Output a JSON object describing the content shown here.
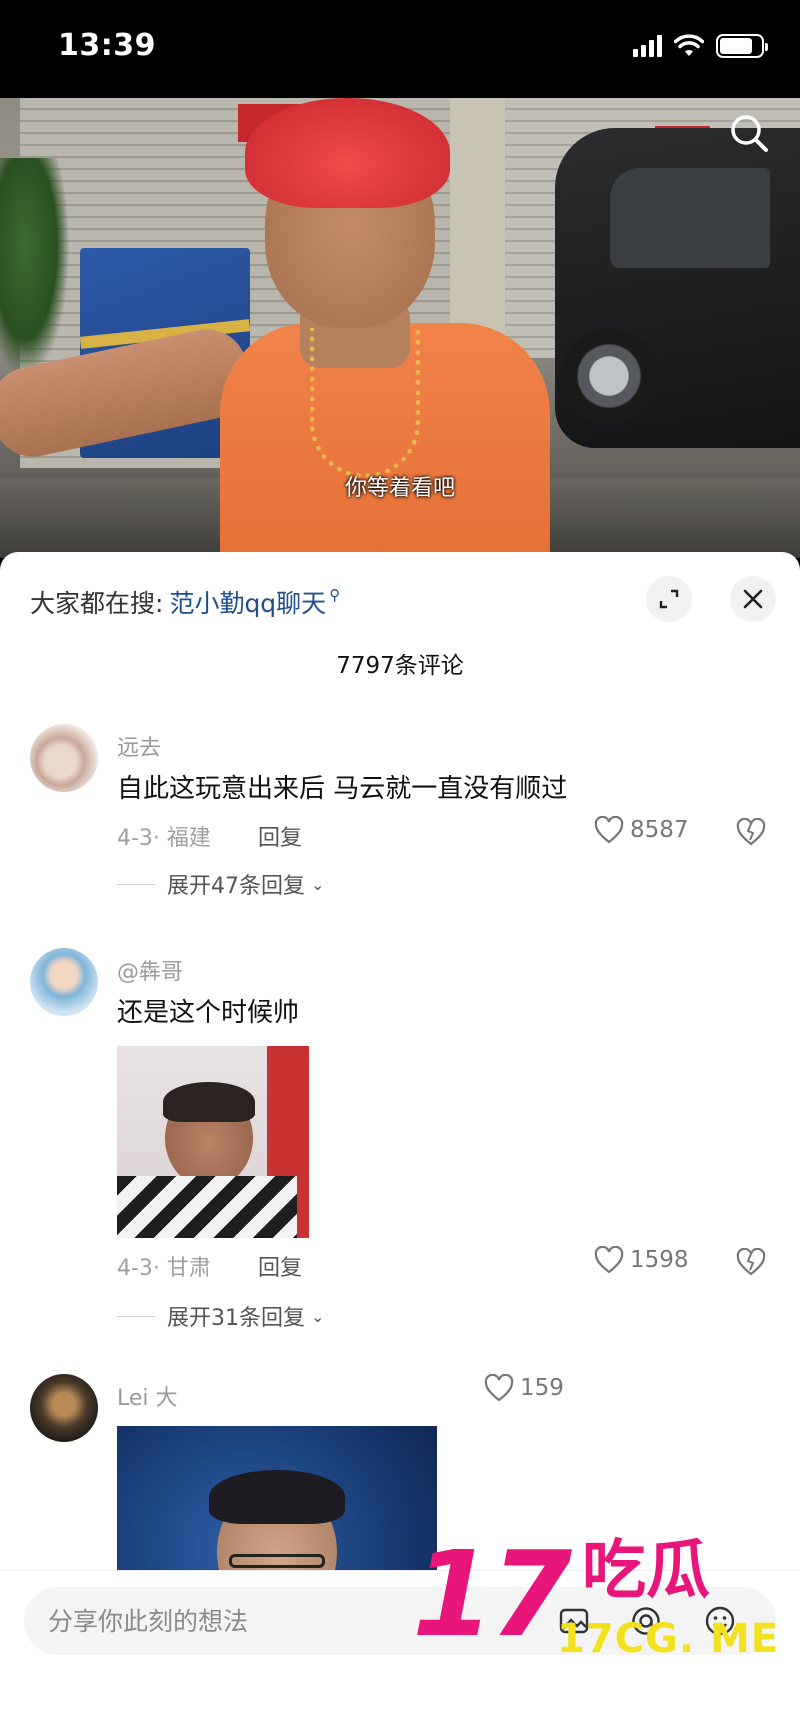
{
  "status_bar": {
    "time": "13:39"
  },
  "video": {
    "subtitle": "你等着看吧"
  },
  "comments_panel": {
    "hot_search_prefix": "大家都在搜:",
    "hot_search_term": "范小勤qq聊天",
    "count_label": "7797条评论"
  },
  "comments": [
    {
      "user": "远去",
      "text": "自此这玩意出来后 马云就一直没有顺过",
      "meta": "4-3· 福建",
      "reply_label": "回复",
      "likes": "8587",
      "expand_label": "展开47条回复"
    },
    {
      "user": "@犇哥",
      "text": "还是这个时候帅",
      "meta": "4-3· 甘肃",
      "reply_label": "回复",
      "likes": "1598",
      "expand_label": "展开31条回复"
    },
    {
      "user": "Lei 大",
      "likes": "159"
    }
  ],
  "input_bar": {
    "placeholder": "分享你此刻的想法"
  },
  "watermark": {
    "number": "17",
    "chinese": "吃瓜",
    "url": "17CG. ME"
  },
  "colors": {
    "accent_link": "#1f4f8c",
    "watermark_pink": "#e8167a",
    "watermark_yellow": "#f2e21d"
  }
}
